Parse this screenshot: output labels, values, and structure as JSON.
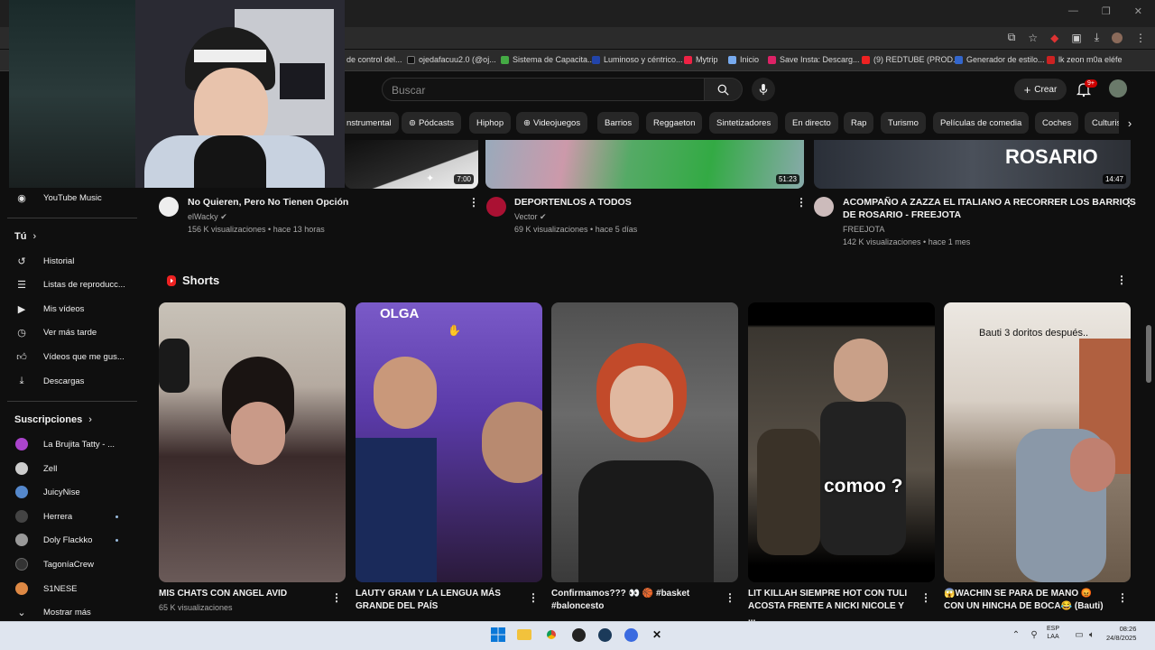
{
  "window": {
    "controls": [
      "—",
      "❐",
      "✕"
    ]
  },
  "bookmarks": [
    {
      "label": "de control del...",
      "color": "#3b5"
    },
    {
      "label": "ojedafacuu2.0 (@oj...",
      "color": "#111"
    },
    {
      "label": "Sistema de Capacita...",
      "color": "#4a4"
    },
    {
      "label": "Luminoso y céntrico...",
      "color": "#24a"
    },
    {
      "label": "Mytrip",
      "color": "#e24"
    },
    {
      "label": "Inicio",
      "color": "#7ae"
    },
    {
      "label": "Save Insta: Descarg...",
      "color": "#d26"
    },
    {
      "label": "(9) REDTUBE (PROD...",
      "color": "#e22"
    },
    {
      "label": "Generador de estilo...",
      "color": "#36c"
    },
    {
      "label": "lk zeon m0a eléfe",
      "color": "#c22"
    }
  ],
  "header": {
    "search_placeholder": "Buscar",
    "create_label": "Crear",
    "notif_badge": "9+"
  },
  "chips": [
    "nstrumental",
    "Pódcasts",
    "Hiphop",
    "Videojuegos",
    "Barrios",
    "Reggaeton",
    "Sintetizadores",
    "En directo",
    "Rap",
    "Turismo",
    "Películas de comedia",
    "Coches",
    "Culturis"
  ],
  "sidebar": {
    "youtube_music": "YouTube Music",
    "tu": "Tú",
    "you_items": [
      {
        "label": "Historial",
        "icon": "history-icon"
      },
      {
        "label": "Listas de reproducc...",
        "icon": "playlist-icon"
      },
      {
        "label": "Mis vídeos",
        "icon": "my-videos-icon"
      },
      {
        "label": "Ver más tarde",
        "icon": "watch-later-icon"
      },
      {
        "label": "Vídeos que me gus...",
        "icon": "liked-icon"
      },
      {
        "label": "Descargas",
        "icon": "download-icon"
      }
    ],
    "subs_title": "Suscripciones",
    "subs": [
      {
        "label": "La Brujita Tatty - ...",
        "color": "#a4c"
      },
      {
        "label": "Zell",
        "color": "#ccc"
      },
      {
        "label": "JuicyNise",
        "color": "#58c"
      },
      {
        "label": "Herrera",
        "color": "#444"
      },
      {
        "label": "Doly Flackko",
        "color": "#999"
      },
      {
        "label": "TagoníaCrew",
        "color": "#333"
      },
      {
        "label": "S1NESE",
        "color": "#d84"
      }
    ],
    "show_more": "Mostrar más"
  },
  "videos": [
    {
      "title": "No Quieren, Pero No Tienen Opción",
      "title2": "",
      "channel": "elWacky",
      "meta": "156 K visualizaciones • hace 13 horas",
      "duration": "7:00"
    },
    {
      "title": "DEPORTENLOS A TODOS",
      "title2": "",
      "channel": "Vector",
      "meta": "69 K visualizaciones • hace 5 días",
      "duration": "51:23"
    },
    {
      "title": "ACOMPAÑO A ZAZZA EL ITALIANO A RECORRER LOS BARRIOS",
      "title2": "DE ROSARIO - FREEJOTA",
      "channel": "FREEJOTA",
      "meta": "142 K visualizaciones • hace 1 mes",
      "duration": "14:47",
      "overlay": "ROSARIO"
    }
  ],
  "shorts": {
    "title": "Shorts",
    "items": [
      {
        "title": "MIS CHATS CON ANGEL AVID",
        "title2": "",
        "meta": "65 K visualizaciones",
        "overlay": ""
      },
      {
        "title": "LAUTY GRAM Y LA LENGUA MÁS",
        "title2": "GRANDE DEL PAÍS",
        "meta": "",
        "overlay": "OLGA"
      },
      {
        "title": "Confirmamos??? 👀 🏀 #basket",
        "title2": "#baloncesto",
        "meta": "",
        "overlay": ""
      },
      {
        "title": "LIT KILLAH SIEMPRE HOT CON TULI",
        "title2": "ACOSTA FRENTE A NICKI NICOLE Y ...",
        "meta": "",
        "overlay": "comoo ?"
      },
      {
        "title": "😱WACHIN SE PARA DE MANO 😡",
        "title2": "CON UN HINCHA DE BOCA😂 (Bauti)",
        "meta": "",
        "overlay": "Bauti 3 doritos después.."
      }
    ]
  },
  "taskbar": {
    "lang1": "ESP",
    "lang2": "LAA",
    "time": "08:26",
    "date": "24/8/2025"
  }
}
